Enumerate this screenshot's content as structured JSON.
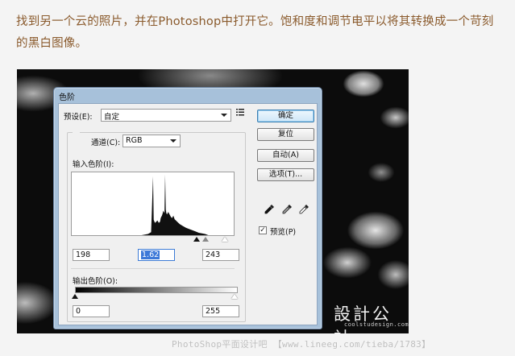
{
  "caption": "找到另一个云的照片，并在Photoshop中打开它。饱和度和调节电平以将其转换成一个苛刻的黑白图像。",
  "dialog": {
    "title": "色阶",
    "preset_label": "预设(E):",
    "preset_value": "自定",
    "channel_label": "通道(C):",
    "channel_value": "RGB",
    "input_levels_label": "输入色阶(I):",
    "input_black": "198",
    "input_gamma": "1.62",
    "input_white": "243",
    "output_levels_label": "输出色阶(O):",
    "output_black": "0",
    "output_white": "255",
    "buttons": {
      "ok": "确定",
      "reset": "复位",
      "auto": "自动(A)",
      "options": "选项(T)..."
    },
    "preview_label": "预览(P)",
    "preview_checked": true,
    "icons": {
      "preset_menu": "preset-menu-icon",
      "black_point": "black-eyedropper-icon",
      "gray_point": "gray-eyedropper-icon",
      "white_point": "white-eyedropper-icon"
    }
  },
  "histogram": {
    "range": [
      0,
      255
    ],
    "bins": [
      [
        0,
        0
      ],
      [
        20,
        0
      ],
      [
        40,
        0
      ],
      [
        60,
        0
      ],
      [
        80,
        0
      ],
      [
        100,
        0
      ],
      [
        110,
        0
      ],
      [
        120,
        0.02
      ],
      [
        125,
        0.05
      ],
      [
        128,
        0.96
      ],
      [
        129,
        0.25
      ],
      [
        131,
        0.2
      ],
      [
        133,
        0.22
      ],
      [
        135,
        0.24
      ],
      [
        137,
        0.2
      ],
      [
        139,
        0.22
      ],
      [
        140,
        0.28
      ],
      [
        141,
        0.3
      ],
      [
        142,
        0.32
      ],
      [
        143,
        0.35
      ],
      [
        144,
        0.4
      ],
      [
        145,
        0.38
      ],
      [
        146,
        0.36
      ],
      [
        147,
        0.99
      ],
      [
        148,
        0.42
      ],
      [
        149,
        0.36
      ],
      [
        150,
        0.34
      ],
      [
        152,
        0.38
      ],
      [
        154,
        0.34
      ],
      [
        156,
        0.3
      ],
      [
        158,
        0.28
      ],
      [
        160,
        0.32
      ],
      [
        162,
        0.26
      ],
      [
        164,
        0.24
      ],
      [
        166,
        0.22
      ],
      [
        168,
        0.2
      ],
      [
        170,
        0.18
      ],
      [
        175,
        0.15
      ],
      [
        180,
        0.12
      ],
      [
        185,
        0.1
      ],
      [
        190,
        0.08
      ],
      [
        195,
        0.06
      ],
      [
        200,
        0.04
      ],
      [
        205,
        0.03
      ],
      [
        210,
        0.02
      ],
      [
        215,
        0.0
      ],
      [
        255,
        0
      ]
    ]
  },
  "watermark": {
    "logo": "設計公社",
    "logo_sub": "coolstudesign.com",
    "footer": "PhotoShop平面设计吧 【www.lineeg.com/tieba/1783】"
  }
}
